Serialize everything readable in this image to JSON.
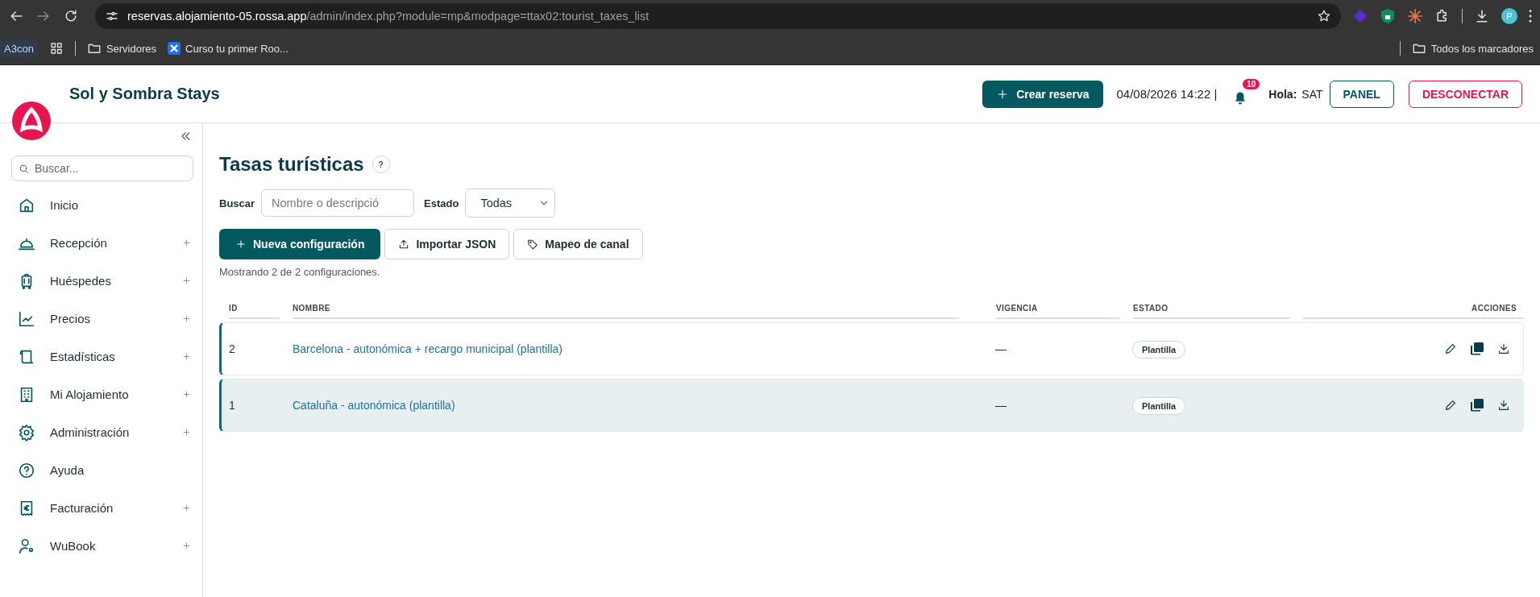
{
  "browser": {
    "url": {
      "host": "reservas.alojamiento-05.rossa.app",
      "path": "/admin/index.php?module=mp&modpage=ttax02:tourist_taxes_list"
    },
    "profile": "P",
    "bookmarks": [
      {
        "kind": "badge",
        "label": "A3con"
      },
      {
        "kind": "apps"
      },
      {
        "kind": "folder",
        "label": "Servidores"
      },
      {
        "kind": "link",
        "label": "Curso tu primer Roo..."
      }
    ],
    "all_bookmarks": "Todos los marcadores"
  },
  "header": {
    "brand": "Sol y Sombra Stays",
    "create_button": "Crear reserva",
    "datetime": "04/08/2026 14:22 |",
    "notifications": "10",
    "greeting": "Hola:",
    "user": "SAT",
    "panel_button": "PANEL",
    "logout_button": "DESCONECTAR"
  },
  "sidebar": {
    "search": {
      "placeholder": "Buscar..."
    },
    "items": [
      {
        "label": "Inicio",
        "expandable": false
      },
      {
        "label": "Recepción",
        "expandable": true
      },
      {
        "label": "Huéspedes",
        "expandable": true
      },
      {
        "label": "Precios",
        "expandable": true
      },
      {
        "label": "Estadísticas",
        "expandable": true
      },
      {
        "label": "Mi Alojamiento",
        "expandable": true
      },
      {
        "label": "Administración",
        "expandable": true
      },
      {
        "label": "Ayuda",
        "expandable": false
      },
      {
        "label": "Facturación",
        "expandable": true
      },
      {
        "label": "WuBook",
        "expandable": true
      }
    ]
  },
  "page": {
    "title": "Tasas turísticas",
    "help": "?",
    "filters": {
      "search_label": "Buscar",
      "search_placeholder": "Nombre o descripció",
      "status_label": "Estado",
      "status_value": "Todas"
    },
    "buttons": [
      {
        "label": "Nueva configuración",
        "kind": "primary"
      },
      {
        "label": "Importar JSON",
        "kind": "secondary"
      },
      {
        "label": "Mapeo de canal",
        "kind": "secondary"
      }
    ],
    "summary": "Mostrando 2 de 2 configuraciones.",
    "table": {
      "columns": [
        "ID",
        "NOMBRE",
        "VIGENCIA",
        "ESTADO",
        "ACCIONES"
      ],
      "rows": [
        {
          "id": "2",
          "name": "Barcelona - autonómica + recargo municipal (plantilla)",
          "validity": "—",
          "status": "Plantilla",
          "selected": false
        },
        {
          "id": "1",
          "name": "Cataluña - autonómica (plantilla)",
          "validity": "—",
          "status": "Plantilla",
          "selected": true
        }
      ]
    }
  }
}
